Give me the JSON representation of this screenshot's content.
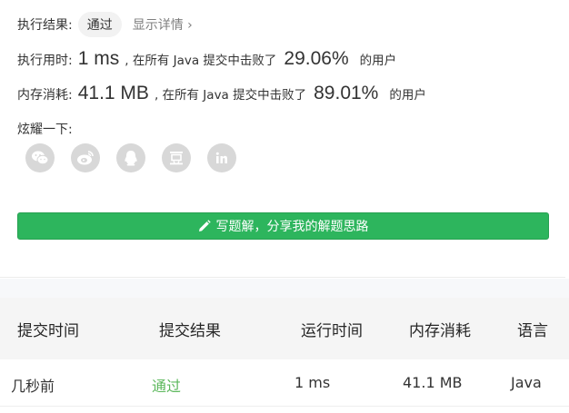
{
  "result": {
    "label": "执行结果:",
    "status": "通过",
    "details_link": "显示详情 ›"
  },
  "runtime": {
    "label": "执行用时:",
    "value": "1 ms",
    "beat_text": ", 在所有 Java 提交中击败了",
    "percent": "29.06%",
    "suffix": "的用户"
  },
  "memory": {
    "label": "内存消耗:",
    "value": "41.1 MB",
    "beat_text": ", 在所有 Java 提交中击败了",
    "percent": "89.01%",
    "suffix": "的用户"
  },
  "share": {
    "label": "炫耀一下:",
    "icons": [
      "wechat-icon",
      "weibo-icon",
      "qq-icon",
      "douban-icon",
      "linkedin-icon"
    ]
  },
  "write_button": {
    "label": "写题解，分享我的解题思路"
  },
  "table": {
    "headers": [
      "提交时间",
      "提交结果",
      "运行时间",
      "内存消耗",
      "语言"
    ],
    "rows": [
      {
        "time": "几秒前",
        "result": "通过",
        "runtime": "1 ms",
        "memory": "41.1 MB",
        "language": "Java"
      }
    ]
  },
  "colors": {
    "accent_green": "#2db55d",
    "pass_green": "#5cb85c",
    "icon_gray": "#d8d8d8"
  }
}
